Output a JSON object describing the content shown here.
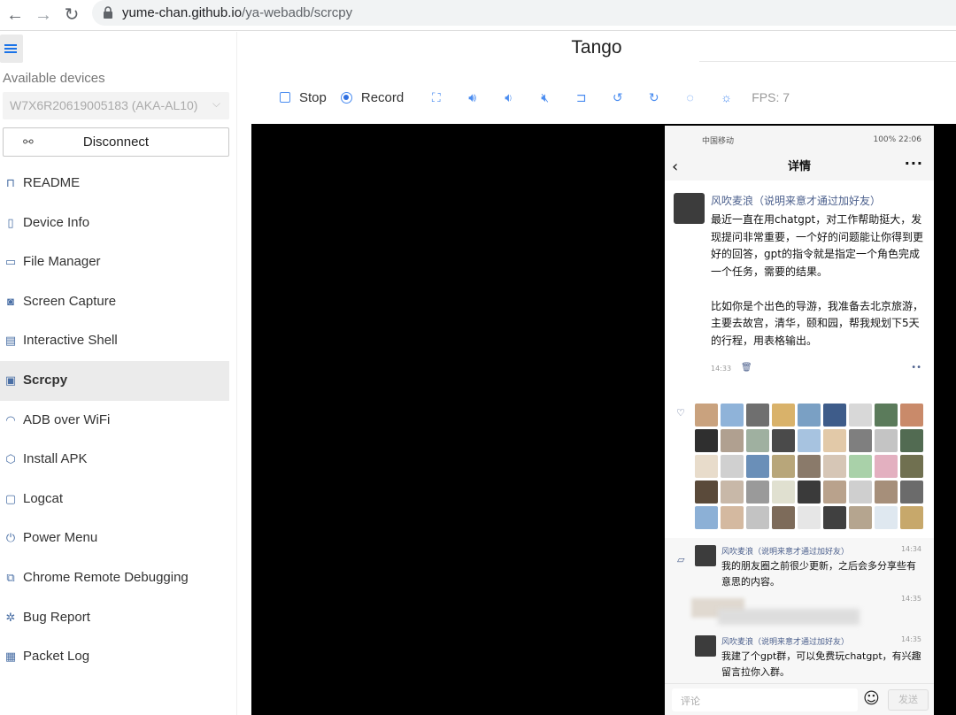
{
  "browser": {
    "url_host": "yume-chan.github.io",
    "url_path": "/ya-webadb/scrcpy"
  },
  "sidebar": {
    "available_label": "Available devices",
    "device": "W7X6R20619005183 (AKA-AL10)",
    "disconnect_label": "Disconnect",
    "items": [
      {
        "label": "README",
        "icon": "bookmark-icon"
      },
      {
        "label": "Device Info",
        "icon": "phone-icon"
      },
      {
        "label": "File Manager",
        "icon": "folder-icon"
      },
      {
        "label": "Screen Capture",
        "icon": "camera-icon"
      },
      {
        "label": "Interactive Shell",
        "icon": "terminal-icon"
      },
      {
        "label": "Scrcpy",
        "icon": "screen-mirror-icon"
      },
      {
        "label": "ADB over WiFi",
        "icon": "wifi-icon"
      },
      {
        "label": "Install APK",
        "icon": "box-icon"
      },
      {
        "label": "Logcat",
        "icon": "logcat-icon"
      },
      {
        "label": "Power Menu",
        "icon": "power-icon"
      },
      {
        "label": "Chrome Remote Debugging",
        "icon": "debug-icon"
      },
      {
        "label": "Bug Report",
        "icon": "bug-icon"
      },
      {
        "label": "Packet Log",
        "icon": "packet-icon"
      }
    ],
    "active_item": "Scrcpy"
  },
  "main": {
    "title": "Tango",
    "toolbar": {
      "stop_label": "Stop",
      "record_label": "Record",
      "fps": "FPS: 7"
    }
  },
  "phone": {
    "status_left": "中国移动",
    "status_right": "100% 22:06",
    "header_title": "详情",
    "post": {
      "author": "风吹麦浪（说明来意才通过加好友）",
      "content": "最近一直在用chatgpt，对工作帮助挺大，发现提问非常重要，一个好的问题能让你得到更好的回答，gpt的指令就是指定一个角色完成一个任务，需要的结果。\n\n比如你是个出色的导游，我准备去北京旅游，主要去故宫，清华，颐和园，帮我规划下5天的行程，用表格输出。",
      "time": "14:33"
    },
    "comments": [
      {
        "author": "风吹麦浪（说明来意才通过加好友）",
        "time": "14:34",
        "text": "我的朋友圈之前很少更新，之后会多分享些有意思的内容。"
      },
      {
        "author": "",
        "time": "14:35",
        "text": ""
      },
      {
        "author": "风吹麦浪（说明来意才通过加好友）",
        "time": "14:35",
        "text": "我建了个gpt群，可以免费玩chatgpt，有兴趣留言拉你入群。"
      }
    ],
    "input_placeholder": "评论",
    "send_label": "发送"
  },
  "colors": {
    "accent": "#4a8cf0",
    "link": "#4b5f8c",
    "active_bg": "#ebebeb"
  }
}
